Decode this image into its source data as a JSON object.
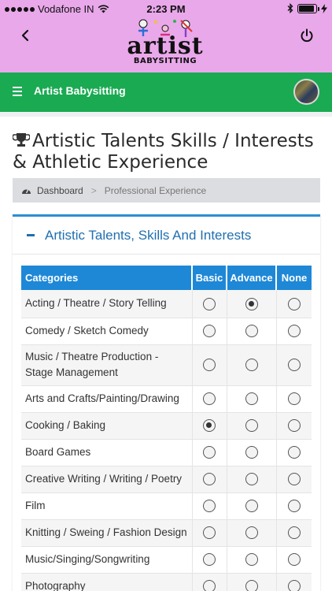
{
  "status_bar": {
    "carrier": "Vodafone IN",
    "time": "2:23 PM",
    "battery_level": 0.9
  },
  "app": {
    "logo_text": "artist",
    "logo_sub": "BABYSITTING",
    "back_icon": "chevron-left-icon",
    "power_icon": "power-icon"
  },
  "navbar": {
    "title": "Artist Babysitting",
    "menu_icon": "hamburger-icon"
  },
  "page": {
    "title": "Artistic Talents Skills / Interests & Athletic Experience",
    "breadcrumb": {
      "home": "Dashboard",
      "current": "Professional Experience"
    }
  },
  "panel": {
    "title": "Artistic Talents, Skills And Interests",
    "columns": [
      "Categories",
      "Basic",
      "Advance",
      "None"
    ],
    "rows": [
      {
        "category": "Acting / Theatre / Story Telling",
        "selected": "Advance"
      },
      {
        "category": "Comedy / Sketch Comedy",
        "selected": ""
      },
      {
        "category": "Music / Theatre Production - Stage Management",
        "selected": ""
      },
      {
        "category": "Arts and Crafts/Painting/Drawing",
        "selected": ""
      },
      {
        "category": "Cooking / Baking",
        "selected": "Basic"
      },
      {
        "category": "Board Games",
        "selected": ""
      },
      {
        "category": "Creative Writing / Writing / Poetry",
        "selected": ""
      },
      {
        "category": "Film",
        "selected": ""
      },
      {
        "category": "Knitting / Sweing / Fashion Design",
        "selected": ""
      },
      {
        "category": "Music/Singing/Songwriting",
        "selected": ""
      },
      {
        "category": "Photography",
        "selected": ""
      }
    ]
  },
  "colors": {
    "header_pink": "#e9a8ea",
    "navbar_green": "#1aaa52",
    "accent_blue": "#1e88d7"
  }
}
